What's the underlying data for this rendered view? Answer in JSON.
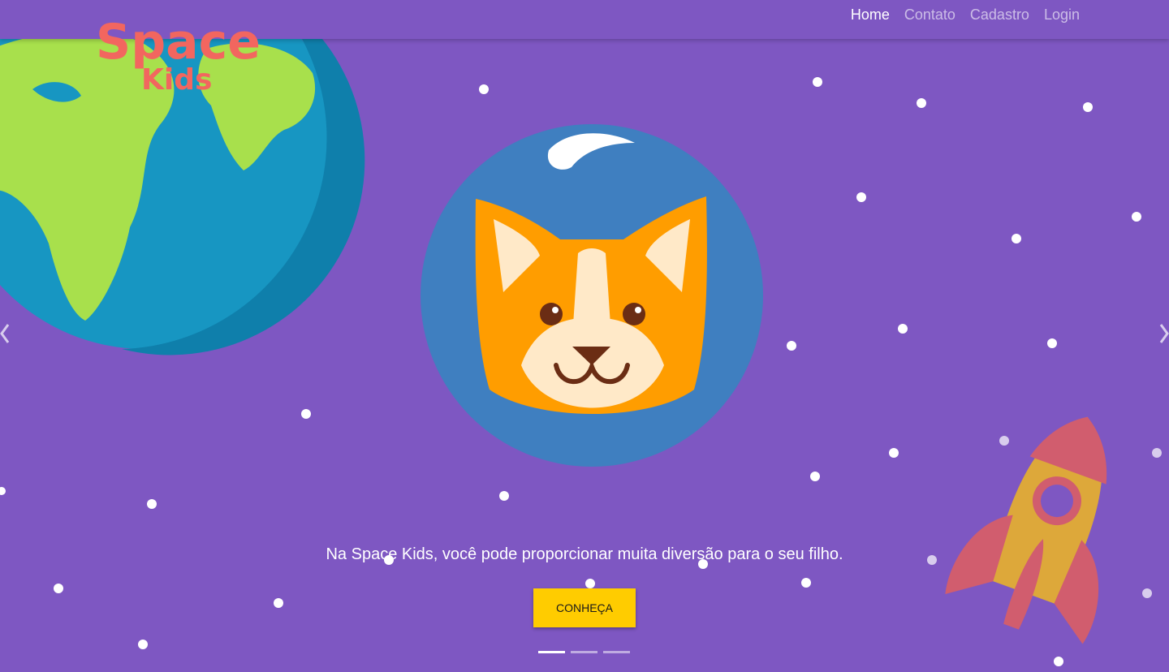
{
  "brand": {
    "line1": "Space",
    "line2": "Kids",
    "color": "#f2665f"
  },
  "nav": {
    "items": [
      {
        "label": "Home",
        "active": true
      },
      {
        "label": "Contato",
        "active": false
      },
      {
        "label": "Cadastro",
        "active": false
      },
      {
        "label": "Login",
        "active": false
      }
    ]
  },
  "carousel": {
    "caption": "Na Space Kids, você pode proporcionar muita diversão para o seu filho.",
    "button_label": "CONHEÇA",
    "indicator_count": 3,
    "active_index": 0,
    "illustrations": [
      "earth-planet",
      "corgi-astronaut",
      "rocket"
    ]
  },
  "colors": {
    "background": "#7e57c2",
    "button": "#ffcc00",
    "helmet": "#3f7fc0",
    "corgi": "#ff9d00",
    "earth_ocean": "#1796c2",
    "earth_land": "#a8e04c",
    "rocket_body": "#dda83a",
    "rocket_fin": "#d15d6e"
  },
  "icons": {
    "prev": "chevron-left-icon",
    "next": "chevron-right-icon"
  }
}
